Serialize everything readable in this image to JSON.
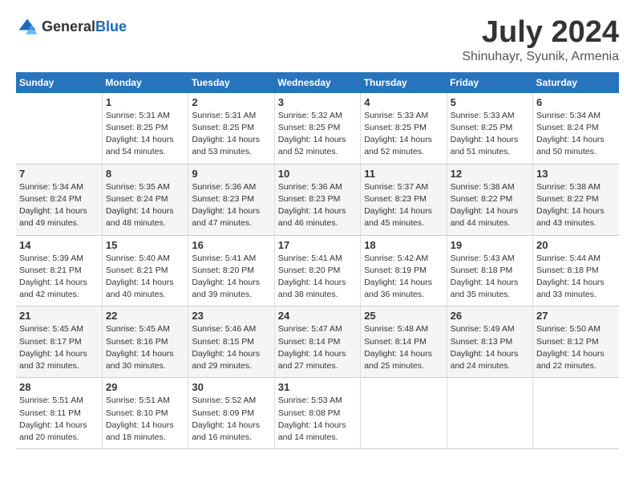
{
  "header": {
    "logo_general": "General",
    "logo_blue": "Blue",
    "month_year": "July 2024",
    "location": "Shinuhayr, Syunik, Armenia"
  },
  "calendar": {
    "days_of_week": [
      "Sunday",
      "Monday",
      "Tuesday",
      "Wednesday",
      "Thursday",
      "Friday",
      "Saturday"
    ],
    "weeks": [
      [
        {
          "day": "",
          "info": ""
        },
        {
          "day": "1",
          "info": "Sunrise: 5:31 AM\nSunset: 8:25 PM\nDaylight: 14 hours\nand 54 minutes."
        },
        {
          "day": "2",
          "info": "Sunrise: 5:31 AM\nSunset: 8:25 PM\nDaylight: 14 hours\nand 53 minutes."
        },
        {
          "day": "3",
          "info": "Sunrise: 5:32 AM\nSunset: 8:25 PM\nDaylight: 14 hours\nand 52 minutes."
        },
        {
          "day": "4",
          "info": "Sunrise: 5:33 AM\nSunset: 8:25 PM\nDaylight: 14 hours\nand 52 minutes."
        },
        {
          "day": "5",
          "info": "Sunrise: 5:33 AM\nSunset: 8:25 PM\nDaylight: 14 hours\nand 51 minutes."
        },
        {
          "day": "6",
          "info": "Sunrise: 5:34 AM\nSunset: 8:24 PM\nDaylight: 14 hours\nand 50 minutes."
        }
      ],
      [
        {
          "day": "7",
          "info": "Sunrise: 5:34 AM\nSunset: 8:24 PM\nDaylight: 14 hours\nand 49 minutes."
        },
        {
          "day": "8",
          "info": "Sunrise: 5:35 AM\nSunset: 8:24 PM\nDaylight: 14 hours\nand 48 minutes."
        },
        {
          "day": "9",
          "info": "Sunrise: 5:36 AM\nSunset: 8:23 PM\nDaylight: 14 hours\nand 47 minutes."
        },
        {
          "day": "10",
          "info": "Sunrise: 5:36 AM\nSunset: 8:23 PM\nDaylight: 14 hours\nand 46 minutes."
        },
        {
          "day": "11",
          "info": "Sunrise: 5:37 AM\nSunset: 8:23 PM\nDaylight: 14 hours\nand 45 minutes."
        },
        {
          "day": "12",
          "info": "Sunrise: 5:38 AM\nSunset: 8:22 PM\nDaylight: 14 hours\nand 44 minutes."
        },
        {
          "day": "13",
          "info": "Sunrise: 5:38 AM\nSunset: 8:22 PM\nDaylight: 14 hours\nand 43 minutes."
        }
      ],
      [
        {
          "day": "14",
          "info": "Sunrise: 5:39 AM\nSunset: 8:21 PM\nDaylight: 14 hours\nand 42 minutes."
        },
        {
          "day": "15",
          "info": "Sunrise: 5:40 AM\nSunset: 8:21 PM\nDaylight: 14 hours\nand 40 minutes."
        },
        {
          "day": "16",
          "info": "Sunrise: 5:41 AM\nSunset: 8:20 PM\nDaylight: 14 hours\nand 39 minutes."
        },
        {
          "day": "17",
          "info": "Sunrise: 5:41 AM\nSunset: 8:20 PM\nDaylight: 14 hours\nand 38 minutes."
        },
        {
          "day": "18",
          "info": "Sunrise: 5:42 AM\nSunset: 8:19 PM\nDaylight: 14 hours\nand 36 minutes."
        },
        {
          "day": "19",
          "info": "Sunrise: 5:43 AM\nSunset: 8:18 PM\nDaylight: 14 hours\nand 35 minutes."
        },
        {
          "day": "20",
          "info": "Sunrise: 5:44 AM\nSunset: 8:18 PM\nDaylight: 14 hours\nand 33 minutes."
        }
      ],
      [
        {
          "day": "21",
          "info": "Sunrise: 5:45 AM\nSunset: 8:17 PM\nDaylight: 14 hours\nand 32 minutes."
        },
        {
          "day": "22",
          "info": "Sunrise: 5:45 AM\nSunset: 8:16 PM\nDaylight: 14 hours\nand 30 minutes."
        },
        {
          "day": "23",
          "info": "Sunrise: 5:46 AM\nSunset: 8:15 PM\nDaylight: 14 hours\nand 29 minutes."
        },
        {
          "day": "24",
          "info": "Sunrise: 5:47 AM\nSunset: 8:14 PM\nDaylight: 14 hours\nand 27 minutes."
        },
        {
          "day": "25",
          "info": "Sunrise: 5:48 AM\nSunset: 8:14 PM\nDaylight: 14 hours\nand 25 minutes."
        },
        {
          "day": "26",
          "info": "Sunrise: 5:49 AM\nSunset: 8:13 PM\nDaylight: 14 hours\nand 24 minutes."
        },
        {
          "day": "27",
          "info": "Sunrise: 5:50 AM\nSunset: 8:12 PM\nDaylight: 14 hours\nand 22 minutes."
        }
      ],
      [
        {
          "day": "28",
          "info": "Sunrise: 5:51 AM\nSunset: 8:11 PM\nDaylight: 14 hours\nand 20 minutes."
        },
        {
          "day": "29",
          "info": "Sunrise: 5:51 AM\nSunset: 8:10 PM\nDaylight: 14 hours\nand 18 minutes."
        },
        {
          "day": "30",
          "info": "Sunrise: 5:52 AM\nSunset: 8:09 PM\nDaylight: 14 hours\nand 16 minutes."
        },
        {
          "day": "31",
          "info": "Sunrise: 5:53 AM\nSunset: 8:08 PM\nDaylight: 14 hours\nand 14 minutes."
        },
        {
          "day": "",
          "info": ""
        },
        {
          "day": "",
          "info": ""
        },
        {
          "day": "",
          "info": ""
        }
      ]
    ]
  }
}
